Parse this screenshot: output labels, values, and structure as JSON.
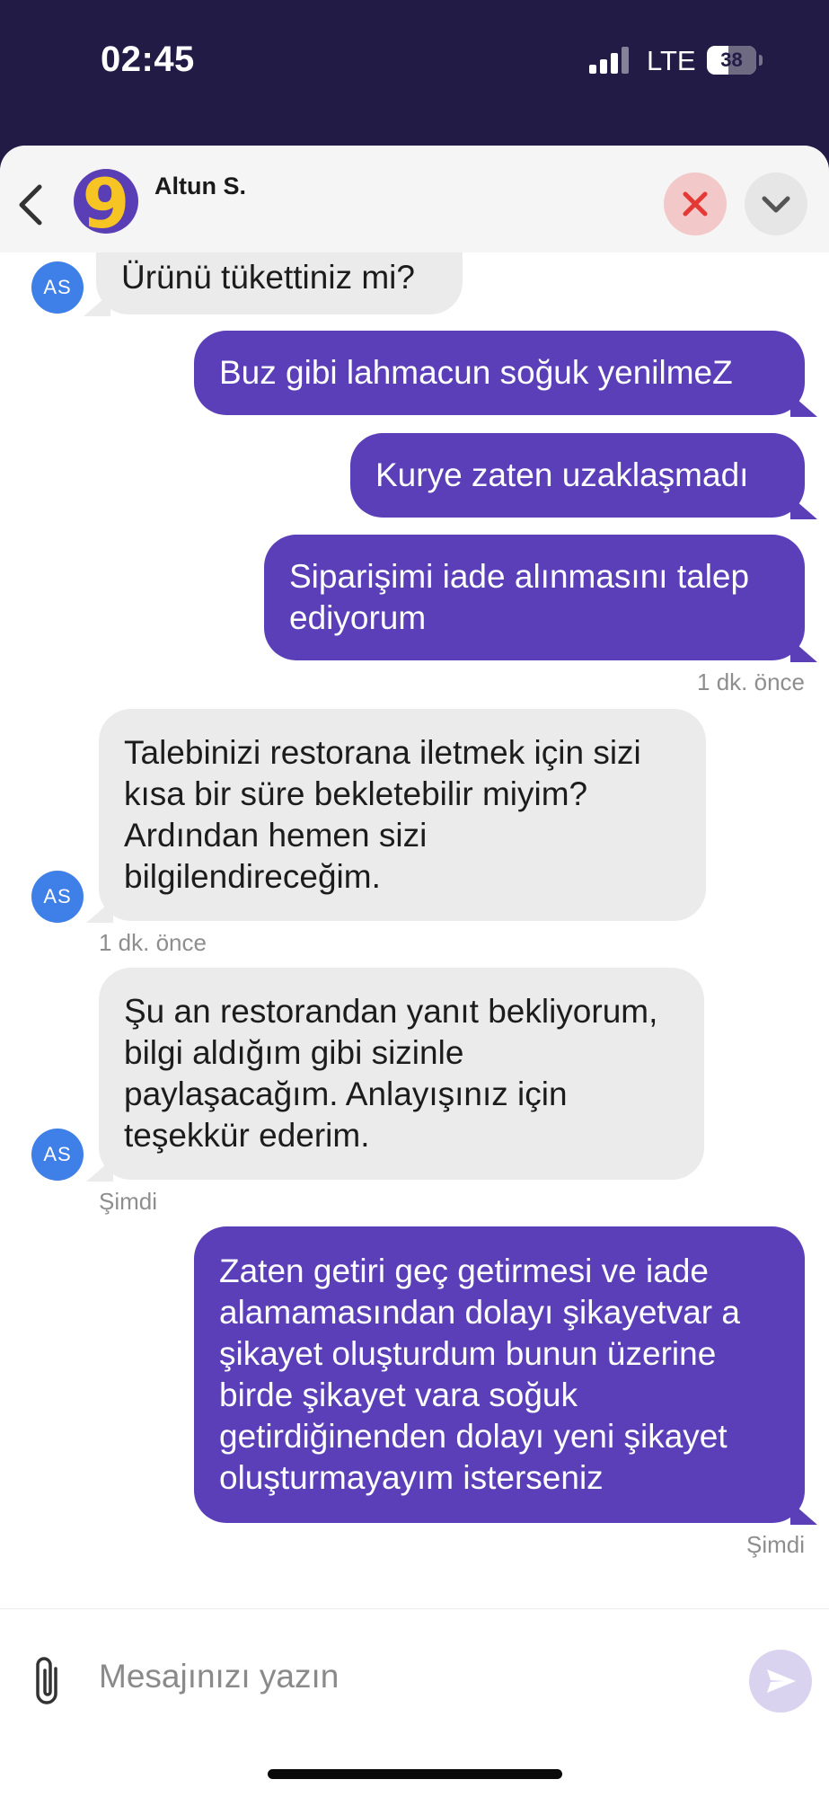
{
  "status_bar": {
    "time": "02:45",
    "network": "LTE",
    "battery": "38"
  },
  "header": {
    "agent_name": "Altun S.",
    "back_icon": "chevron-left-icon",
    "close_icon": "close-x-icon",
    "collapse_icon": "chevron-down-icon",
    "close_color": "#e53935"
  },
  "agent_initials": "AS",
  "messages": [
    {
      "from": "agent",
      "text": "Ürünü tükettiniz mi?"
    },
    {
      "from": "user",
      "text": "Buz gibi lahmacun soğuk yenilmeZ"
    },
    {
      "from": "user",
      "text": "Kurye zaten uzaklaşmadı"
    },
    {
      "from": "user",
      "text": "Siparişimi iade alınmasını talep ediyorum",
      "time": "1 dk. önce"
    },
    {
      "from": "agent",
      "text": "Talebinizi restorana iletmek için sizi kısa bir süre bekletebilir miyim? Ardından hemen sizi bilgilendireceğim.",
      "time": "1 dk. önce"
    },
    {
      "from": "agent",
      "text": "Şu an restorandan yanıt bekliyorum, bilgi aldığım gibi sizinle paylaşacağım. Anlayışınız için teşekkür ederim.",
      "time": "Şimdi"
    },
    {
      "from": "user",
      "text": "Zaten getiri geç getirmesi ve iade alamamasından dolayı şikayetvar a şikayet oluşturdum bunun üzerine birde şikayet vara soğuk getirdiğinenden dolayı yeni şikayet oluşturmayayım isterseniz",
      "time": "Şimdi"
    }
  ],
  "composer": {
    "placeholder": "Mesajınızı yazın",
    "attach_icon": "paperclip-icon",
    "send_icon": "send-icon"
  },
  "colors": {
    "brand_purple": "#5b3fb8",
    "status_bg": "#211b46",
    "incoming_bubble": "#ebebeb",
    "agent_avatar": "#3f7fe8"
  }
}
